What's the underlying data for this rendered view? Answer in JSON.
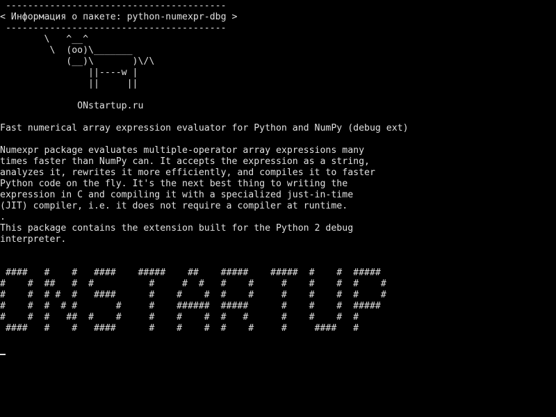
{
  "screen": {
    "colors": {
      "background": "#000000",
      "foreground": "#e0e0e0"
    },
    "lines": [
      " ----------------------------------------",
      "< Информация о пакете: python-numexpr-dbg >",
      " ----------------------------------------",
      "        \\   ^__^",
      "         \\  (oo)\\_______",
      "            (__)\\       )\\/\\",
      "                ||----w |",
      "                ||     ||",
      "",
      "              ONstartup.ru",
      "",
      "Fast numerical array expression evaluator for Python and NumPy (debug ext)",
      "",
      "Numexpr package evaluates multiple-operator array expressions many",
      "times faster than NumPy can. It accepts the expression as a string,",
      "analyzes it, rewrites it more efficiently, and compiles it to faster",
      "Python code on the fly. It's the next best thing to writing the",
      "expression in C and compiling it with a specialized just-in-time",
      "(JIT) compiler, i.e. it does not require a compiler at runtime.",
      ".",
      "This package contains the extension built for the Python 2 debug",
      "interpreter.",
      "",
      "",
      " ####   #    #   ####    #####    ##    #####    #####  #    #  #####",
      "#    #  ##   #  #          #     #  #   #    #     #    #    #  #    #",
      "#    #  # #  #   ####      #    #    #  #    #     #    #    #  #    #",
      "#    #  #  # #       #     #    ######  #####      #    #    #  #####",
      "#    #  #   ##  #    #     #    #    #  #   #      #    #    #  #",
      " ####   #    #   ####      #    #    #  #    #     #     ####   #"
    ]
  }
}
